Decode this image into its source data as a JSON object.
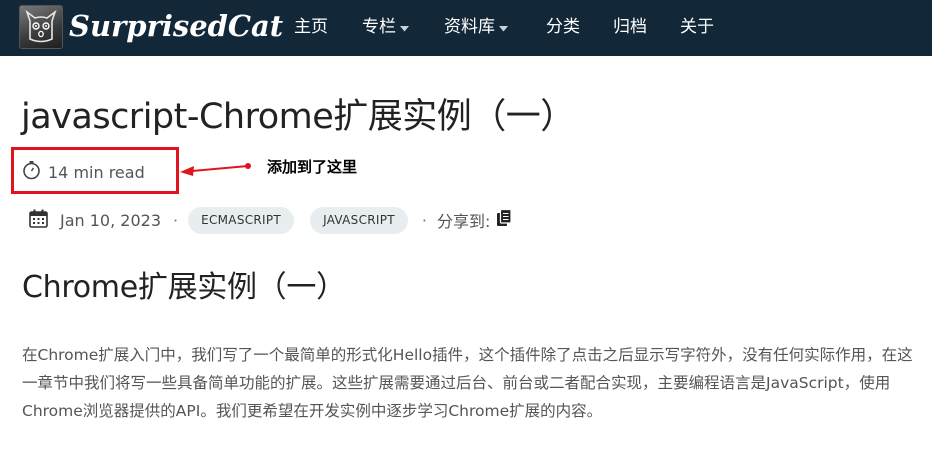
{
  "nav": {
    "brand": "SurprisedCat",
    "items": [
      {
        "label": "主页",
        "has_dropdown": false
      },
      {
        "label": "专栏",
        "has_dropdown": true
      },
      {
        "label": "资料库",
        "has_dropdown": true
      },
      {
        "label": "分类",
        "has_dropdown": false
      },
      {
        "label": "归档",
        "has_dropdown": false
      },
      {
        "label": "关于",
        "has_dropdown": false
      }
    ]
  },
  "post": {
    "title": "javascript-Chrome扩展实例（一）",
    "read_time": "14 min read",
    "date": "Jan 10, 2023",
    "tags": [
      "ECMASCRIPT",
      "JAVASCRIPT"
    ],
    "share_label": "分享到:"
  },
  "annotation": {
    "text": "添加到了这里",
    "color": "#e0141c"
  },
  "content": {
    "heading": "Chrome扩展实例（一）",
    "paragraph": "在Chrome扩展入门中，我们写了一个最简单的形式化Hello插件，这个插件除了点击之后显示写字符外，没有任何实际作用，在这一章节中我们将写一些具备简单功能的扩展。这些扩展需要通过后台、前台或二者配合实现，主要编程语言是JavaScript，使用Chrome浏览器提供的API。我们更希望在开发实例中逐步学习Chrome扩展的内容。"
  },
  "colors": {
    "navbar_bg": "#122838",
    "tag_bg": "#e8edf0",
    "body_text": "#555555"
  }
}
